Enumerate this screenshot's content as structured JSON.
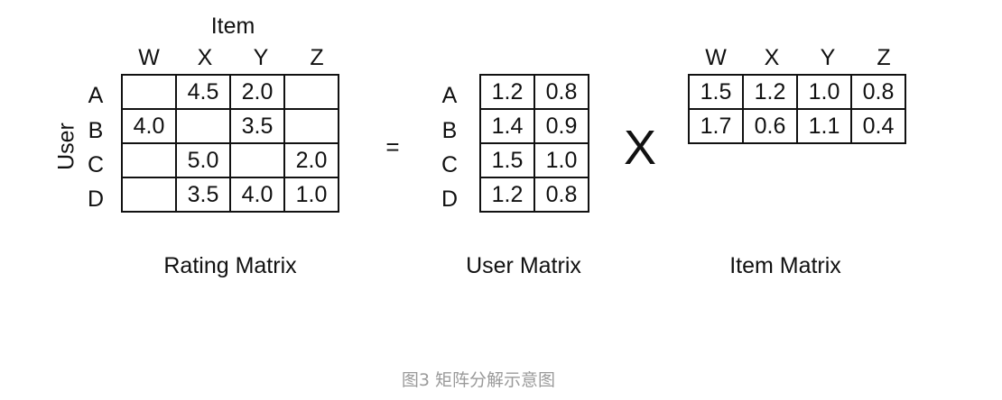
{
  "rating": {
    "axis_top": "Item",
    "axis_side": "User",
    "columns": [
      "W",
      "X",
      "Y",
      "Z"
    ],
    "rows": [
      "A",
      "B",
      "C",
      "D"
    ],
    "cells": [
      [
        "",
        "4.5",
        "2.0",
        ""
      ],
      [
        "4.0",
        "",
        "3.5",
        ""
      ],
      [
        "",
        "5.0",
        "",
        "2.0"
      ],
      [
        "",
        "3.5",
        "4.0",
        "1.0"
      ]
    ],
    "caption": "Rating Matrix"
  },
  "equals": "=",
  "user": {
    "rows": [
      "A",
      "B",
      "C",
      "D"
    ],
    "cells": [
      [
        "1.2",
        "0.8"
      ],
      [
        "1.4",
        "0.9"
      ],
      [
        "1.5",
        "1.0"
      ],
      [
        "1.2",
        "0.8"
      ]
    ],
    "caption": "User Matrix"
  },
  "times": "X",
  "item": {
    "columns": [
      "W",
      "X",
      "Y",
      "Z"
    ],
    "cells": [
      [
        "1.5",
        "1.2",
        "1.0",
        "0.8"
      ],
      [
        "1.7",
        "0.6",
        "1.1",
        "0.4"
      ]
    ],
    "caption": "Item Matrix"
  },
  "footer": "图3 矩阵分解示意图"
}
